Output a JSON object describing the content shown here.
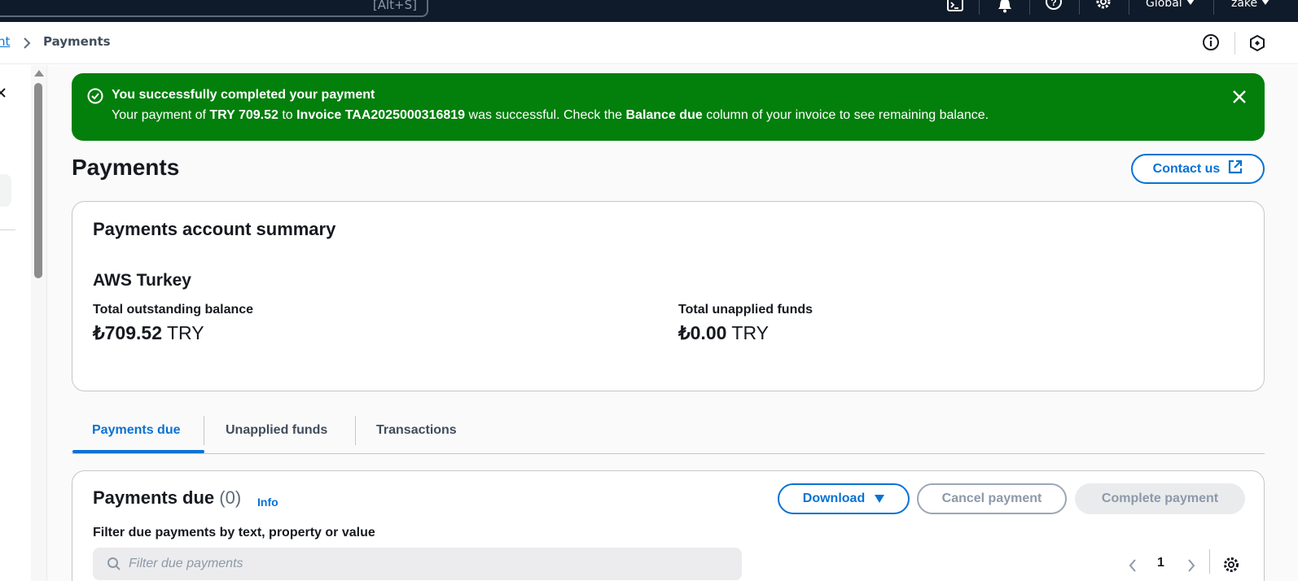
{
  "topnav": {
    "search_shortcut": "[Alt+S]",
    "region_label": "Global",
    "user_label": "zake"
  },
  "breadcrumb": {
    "parent_label": "nt",
    "current_label": "Payments"
  },
  "flash": {
    "title": "You successfully completed your payment",
    "msg_prefix": "Your payment of ",
    "amount": "TRY 709.52",
    "msg_to": " to ",
    "invoice": "Invoice TAA2025000316819",
    "msg_middle": " was successful. Check the ",
    "column_name": "Balance due",
    "msg_suffix": " column of your invoice to see remaining balance."
  },
  "page": {
    "title": "Payments",
    "contact_label": "Contact us"
  },
  "summary": {
    "heading": "Payments account summary",
    "entity": "AWS Turkey",
    "outstanding_label": "Total outstanding balance",
    "outstanding_amount": "₺709.52",
    "outstanding_currency": "TRY",
    "unapplied_label": "Total unapplied funds",
    "unapplied_amount": "₺0.00",
    "unapplied_currency": "TRY"
  },
  "tabs": [
    {
      "label": "Payments due",
      "active": true
    },
    {
      "label": "Unapplied funds",
      "active": false
    },
    {
      "label": "Transactions",
      "active": false
    }
  ],
  "due": {
    "heading": "Payments due",
    "count": "(0)",
    "info_label": "Info",
    "download_label": "Download",
    "cancel_label": "Cancel payment",
    "complete_label": "Complete payment",
    "filter_label": "Filter due payments by text, property or value",
    "filter_placeholder": "Filter due payments",
    "filter_value": "",
    "page_number": "1"
  },
  "colors": {
    "nav_bg": "#0f1b2a",
    "success": "#037f0c",
    "accent": "#0972d3"
  }
}
